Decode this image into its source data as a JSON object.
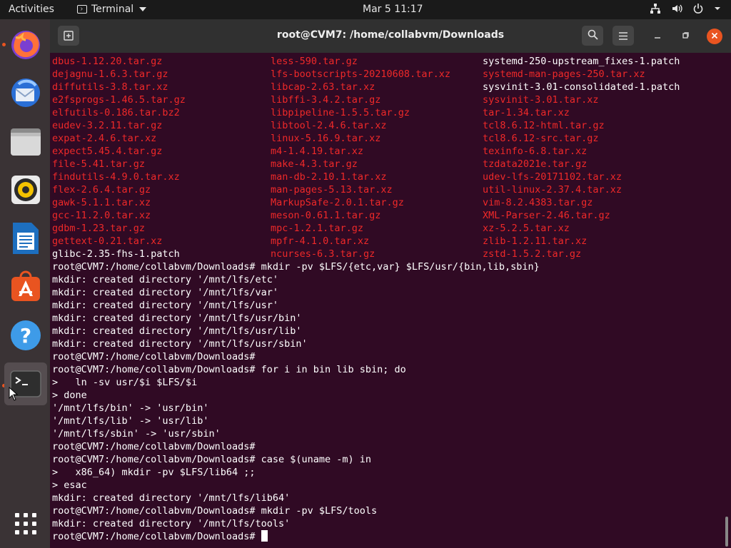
{
  "topbar": {
    "activities": "Activities",
    "app_name": "Terminal",
    "clock": "Mar 5  11:17"
  },
  "window": {
    "title": "root@CVM7: /home/collabvm/Downloads"
  },
  "dock": {
    "apps": [
      "firefox-icon",
      "thunderbird-icon",
      "files-icon",
      "rhythmbox-icon",
      "writer-icon",
      "software-icon",
      "help-icon",
      "terminal-icon"
    ]
  },
  "terminal": {
    "files_col1": [
      {
        "t": "dbus-1.12.20.tar.gz",
        "c": "red"
      },
      {
        "t": "dejagnu-1.6.3.tar.gz",
        "c": "red"
      },
      {
        "t": "diffutils-3.8.tar.xz",
        "c": "red"
      },
      {
        "t": "e2fsprogs-1.46.5.tar.gz",
        "c": "red"
      },
      {
        "t": "elfutils-0.186.tar.bz2",
        "c": "red"
      },
      {
        "t": "eudev-3.2.11.tar.gz",
        "c": "red"
      },
      {
        "t": "expat-2.4.6.tar.xz",
        "c": "red"
      },
      {
        "t": "expect5.45.4.tar.gz",
        "c": "red"
      },
      {
        "t": "file-5.41.tar.gz",
        "c": "red"
      },
      {
        "t": "findutils-4.9.0.tar.xz",
        "c": "red"
      },
      {
        "t": "flex-2.6.4.tar.gz",
        "c": "red"
      },
      {
        "t": "gawk-5.1.1.tar.xz",
        "c": "red"
      },
      {
        "t": "gcc-11.2.0.tar.xz",
        "c": "red"
      },
      {
        "t": "gdbm-1.23.tar.gz",
        "c": "red"
      },
      {
        "t": "gettext-0.21.tar.xz",
        "c": "red"
      },
      {
        "t": "glibc-2.35-fhs-1.patch",
        "c": "white"
      }
    ],
    "files_col2": [
      {
        "t": "less-590.tar.gz",
        "c": "red"
      },
      {
        "t": "lfs-bootscripts-20210608.tar.xz",
        "c": "red"
      },
      {
        "t": "libcap-2.63.tar.xz",
        "c": "red"
      },
      {
        "t": "libffi-3.4.2.tar.gz",
        "c": "red"
      },
      {
        "t": "libpipeline-1.5.5.tar.gz",
        "c": "red"
      },
      {
        "t": "libtool-2.4.6.tar.xz",
        "c": "red"
      },
      {
        "t": "linux-5.16.9.tar.xz",
        "c": "red"
      },
      {
        "t": "m4-1.4.19.tar.xz",
        "c": "red"
      },
      {
        "t": "make-4.3.tar.gz",
        "c": "red"
      },
      {
        "t": "man-db-2.10.1.tar.xz",
        "c": "red"
      },
      {
        "t": "man-pages-5.13.tar.xz",
        "c": "red"
      },
      {
        "t": "MarkupSafe-2.0.1.tar.gz",
        "c": "red"
      },
      {
        "t": "meson-0.61.1.tar.gz",
        "c": "red"
      },
      {
        "t": "mpc-1.2.1.tar.gz",
        "c": "red"
      },
      {
        "t": "mpfr-4.1.0.tar.xz",
        "c": "red"
      },
      {
        "t": "ncurses-6.3.tar.gz",
        "c": "red"
      }
    ],
    "files_col3": [
      {
        "t": "systemd-250-upstream_fixes-1.patch",
        "c": "white"
      },
      {
        "t": "systemd-man-pages-250.tar.xz",
        "c": "red"
      },
      {
        "t": "sysvinit-3.01-consolidated-1.patch",
        "c": "white"
      },
      {
        "t": "sysvinit-3.01.tar.xz",
        "c": "red"
      },
      {
        "t": "tar-1.34.tar.xz",
        "c": "red"
      },
      {
        "t": "tcl8.6.12-html.tar.gz",
        "c": "red"
      },
      {
        "t": "tcl8.6.12-src.tar.gz",
        "c": "red"
      },
      {
        "t": "texinfo-6.8.tar.xz",
        "c": "red"
      },
      {
        "t": "tzdata2021e.tar.gz",
        "c": "red"
      },
      {
        "t": "udev-lfs-20171102.tar.xz",
        "c": "red"
      },
      {
        "t": "util-linux-2.37.4.tar.xz",
        "c": "red"
      },
      {
        "t": "vim-8.2.4383.tar.gz",
        "c": "red"
      },
      {
        "t": "XML-Parser-2.46.tar.gz",
        "c": "red"
      },
      {
        "t": "xz-5.2.5.tar.xz",
        "c": "red"
      },
      {
        "t": "zlib-1.2.11.tar.xz",
        "c": "red"
      },
      {
        "t": "zstd-1.5.2.tar.gz",
        "c": "red"
      }
    ],
    "lines": [
      "root@CVM7:/home/collabvm/Downloads# mkdir -pv $LFS/{etc,var} $LFS/usr/{bin,lib,sbin}",
      "mkdir: created directory '/mnt/lfs/etc'",
      "mkdir: created directory '/mnt/lfs/var'",
      "mkdir: created directory '/mnt/lfs/usr'",
      "mkdir: created directory '/mnt/lfs/usr/bin'",
      "mkdir: created directory '/mnt/lfs/usr/lib'",
      "mkdir: created directory '/mnt/lfs/usr/sbin'",
      "root@CVM7:/home/collabvm/Downloads#",
      "root@CVM7:/home/collabvm/Downloads# for i in bin lib sbin; do",
      ">   ln -sv usr/$i $LFS/$i",
      "> done",
      "'/mnt/lfs/bin' -> 'usr/bin'",
      "'/mnt/lfs/lib' -> 'usr/lib'",
      "'/mnt/lfs/sbin' -> 'usr/sbin'",
      "root@CVM7:/home/collabvm/Downloads#",
      "root@CVM7:/home/collabvm/Downloads# case $(uname -m) in",
      ">   x86_64) mkdir -pv $LFS/lib64 ;;",
      "> esac",
      "mkdir: created directory '/mnt/lfs/lib64'",
      "root@CVM7:/home/collabvm/Downloads# mkdir -pv $LFS/tools",
      "mkdir: created directory '/mnt/lfs/tools'"
    ],
    "prompt": "root@CVM7:/home/collabvm/Downloads# "
  },
  "colors": {
    "terminal_bg": "#300a24",
    "red": "#ef2929",
    "accent": "#e95420"
  }
}
